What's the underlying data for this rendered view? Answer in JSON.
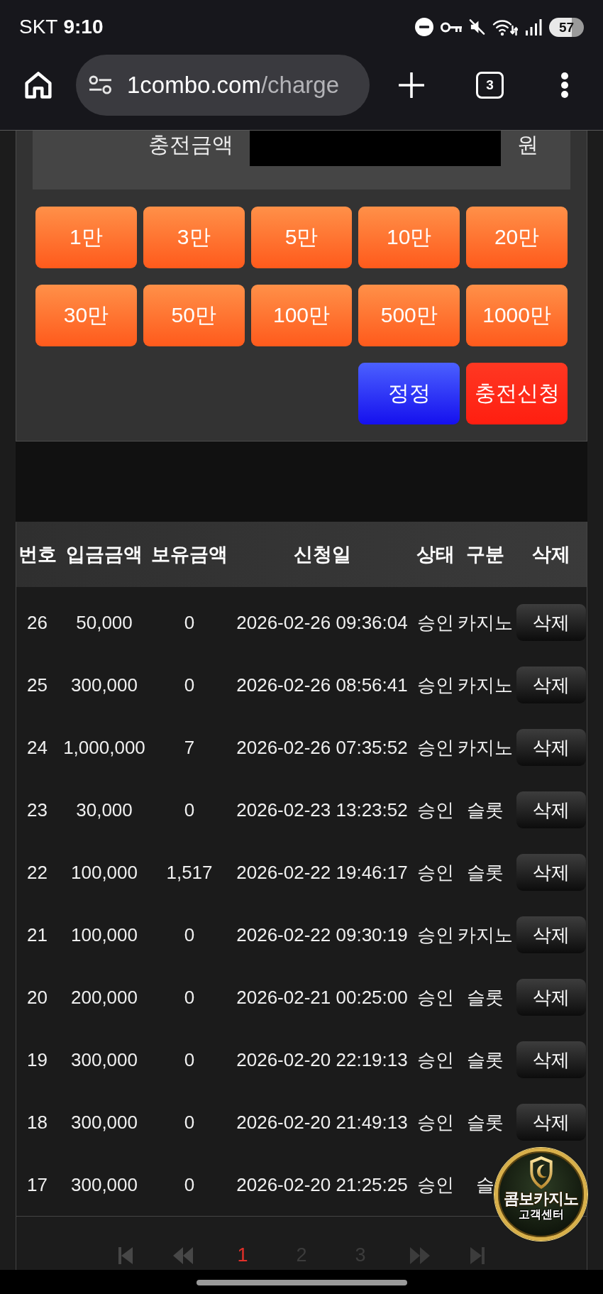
{
  "status_bar": {
    "carrier": "SKT",
    "time": "9:10",
    "battery": "57"
  },
  "browser_toolbar": {
    "address": {
      "host": "1combo.com",
      "path": "/charge"
    },
    "tab_count": "3"
  },
  "charge_form": {
    "amount_label": "충전금액",
    "unit": "원",
    "presets": [
      "1만",
      "3만",
      "5만",
      "10만",
      "20만",
      "30만",
      "50만",
      "100만",
      "500만",
      "1000만"
    ],
    "actions": [
      {
        "label": "정정",
        "kind": "reset"
      },
      {
        "label": "충전신청",
        "kind": "submit"
      }
    ]
  },
  "table": {
    "columns": [
      "번호",
      "입금금액",
      "보유금액",
      "신청일",
      "상태",
      "구분",
      "삭제"
    ],
    "rows": [
      {
        "no": "26",
        "deposit": "50,000",
        "balance": "0",
        "date": "2026-02-26 09:36:04",
        "status": "승인",
        "category": "카지노",
        "delete": "삭제"
      },
      {
        "no": "25",
        "deposit": "300,000",
        "balance": "0",
        "date": "2026-02-26 08:56:41",
        "status": "승인",
        "category": "카지노",
        "delete": "삭제"
      },
      {
        "no": "24",
        "deposit": "1,000,000",
        "balance": "7",
        "date": "2026-02-26 07:35:52",
        "status": "승인",
        "category": "카지노",
        "delete": "삭제"
      },
      {
        "no": "23",
        "deposit": "30,000",
        "balance": "0",
        "date": "2026-02-23 13:23:52",
        "status": "승인",
        "category": "슬롯",
        "delete": "삭제"
      },
      {
        "no": "22",
        "deposit": "100,000",
        "balance": "1,517",
        "date": "2026-02-22 19:46:17",
        "status": "승인",
        "category": "슬롯",
        "delete": "삭제"
      },
      {
        "no": "21",
        "deposit": "100,000",
        "balance": "0",
        "date": "2026-02-22 09:30:19",
        "status": "승인",
        "category": "카지노",
        "delete": "삭제"
      },
      {
        "no": "20",
        "deposit": "200,000",
        "balance": "0",
        "date": "2026-02-21 00:25:00",
        "status": "승인",
        "category": "슬롯",
        "delete": "삭제"
      },
      {
        "no": "19",
        "deposit": "300,000",
        "balance": "0",
        "date": "2026-02-20 22:19:13",
        "status": "승인",
        "category": "슬롯",
        "delete": "삭제"
      },
      {
        "no": "18",
        "deposit": "300,000",
        "balance": "0",
        "date": "2026-02-20 21:49:13",
        "status": "승인",
        "category": "슬롯",
        "delete": "삭제"
      },
      {
        "no": "17",
        "deposit": "300,000",
        "balance": "0",
        "date": "2026-02-20 21:25:25",
        "status": "승인",
        "category": "슬"
      }
    ]
  },
  "pagination": {
    "items": [
      {
        "kind": "first"
      },
      {
        "kind": "prev"
      },
      {
        "kind": "page",
        "label": "1",
        "selected": true
      },
      {
        "kind": "page",
        "label": "2",
        "selected": false
      },
      {
        "kind": "page",
        "label": "3",
        "selected": false
      },
      {
        "kind": "next"
      },
      {
        "kind": "last"
      }
    ]
  },
  "support_badge": {
    "title": "콤보카지노",
    "subtitle": "고객센터"
  }
}
